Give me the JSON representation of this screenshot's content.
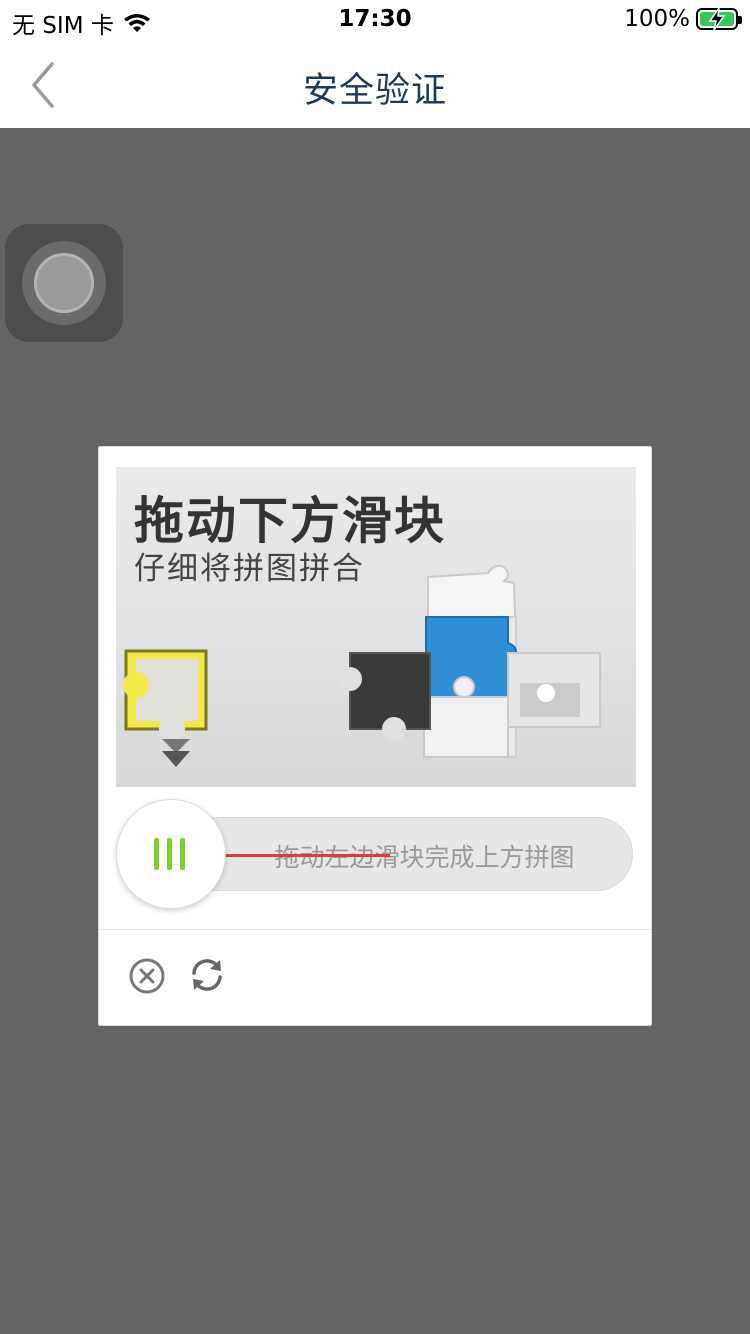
{
  "status_bar": {
    "carrier": "无 SIM 卡",
    "time": "17:30",
    "battery": "100%"
  },
  "nav": {
    "title": "安全验证"
  },
  "captcha": {
    "image_heading": "拖动下方滑块",
    "image_subheading": "仔细将拼图拼合",
    "slider_hint": "拖动左边滑块完成上方拼图"
  },
  "colors": {
    "nav_title": "#1f3a55",
    "overlay": "#646464",
    "handle_bars": "#7bd12a",
    "puzzle_piece": "#f2ea4b",
    "puzzle_blue": "#2f8fd6",
    "guide_line": "#e53935"
  },
  "icons": {
    "back": "chevron-left-icon",
    "wifi": "wifi-icon",
    "battery": "battery-charging-icon",
    "close": "close-circle-icon",
    "refresh": "refresh-icon",
    "assistive": "assistive-touch-icon"
  }
}
